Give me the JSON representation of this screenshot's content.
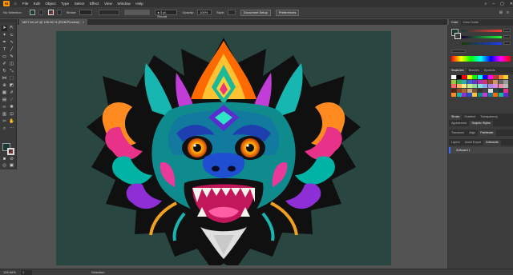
{
  "menubar": {
    "logo": "Ai",
    "items": [
      "File",
      "Edit",
      "Object",
      "Type",
      "Select",
      "Effect",
      "View",
      "Window",
      "Help"
    ]
  },
  "controlbar": {
    "selection": "No Selection",
    "stroke_label": "Stroke:",
    "brush": "3 pt. Round",
    "opacity_label": "Opacity:",
    "opacity": "100%",
    "style_label": "Style:",
    "doc_setup": "Document Setup",
    "preferences": "Preferences"
  },
  "document": {
    "tab_title": "MET Art.ai* @ 106.96 % (RGB/Preview)",
    "close": "×"
  },
  "status": {
    "zoom": "106.96%",
    "artboard": "1",
    "tool": "Selection"
  },
  "panels": {
    "color_tabs": [
      "Color",
      "Color Guide"
    ],
    "swatch_tabs": [
      "Swatches",
      "Brushes",
      "Symbols"
    ],
    "mid_tabs": [
      "Stroke",
      "Gradient",
      "Transparency"
    ],
    "mid_tabs2": [
      "Appearance",
      "Graphic Styles"
    ],
    "mid_tabs3": [
      "Transform",
      "Align",
      "Pathfinder"
    ],
    "layers_tabs": [
      "Layers",
      "Asset Export",
      "Artboards"
    ],
    "layers_row": "Artboard 1"
  },
  "colors": {
    "artboard": "#2a4641",
    "accent": "#ff9a00"
  }
}
